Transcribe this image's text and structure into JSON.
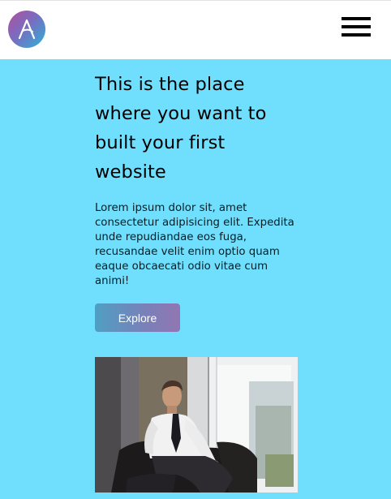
{
  "navbar": {
    "logo_icon": "logo-a-icon",
    "menu_icon": "hamburger-menu-icon"
  },
  "hero": {
    "headline": "This is the place where you want to built your first website",
    "body": "Lorem ipsum dolor sit, amet consectetur adipisicing elit. Expedita unde repudiandae eos fuga, recusandae velit enim optio quam eaque obcaecati odio vitae cum animi!",
    "button_label": "Explore"
  },
  "colors": {
    "page_background": "#6fdffd",
    "navbar_background": "#ffffff",
    "button_gradient_start": "#4f9fc3",
    "button_gradient_end": "#9176b2"
  }
}
